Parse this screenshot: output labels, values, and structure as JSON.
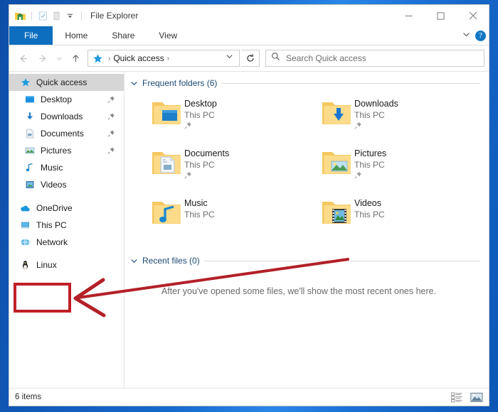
{
  "window": {
    "title": "File Explorer",
    "quick_access_toolbar": [
      {
        "name": "app-icon",
        "icon": "folder-home-icon"
      },
      {
        "name": "properties-button",
        "icon": "properties-icon"
      },
      {
        "name": "new-folder-button",
        "icon": "new-folder-icon"
      },
      {
        "name": "customize-toolbar-button",
        "icon": "chevron-down-icon"
      }
    ],
    "controls": [
      {
        "name": "minimize-button",
        "icon": "minimize-icon"
      },
      {
        "name": "maximize-button",
        "icon": "maximize-icon"
      },
      {
        "name": "close-button",
        "icon": "close-icon"
      }
    ]
  },
  "ribbon": {
    "tabs": [
      {
        "label": "File",
        "active": true
      },
      {
        "label": "Home",
        "active": false
      },
      {
        "label": "Share",
        "active": false
      },
      {
        "label": "View",
        "active": false
      }
    ],
    "expand_icon": "chevron-down-icon",
    "help_label": "?"
  },
  "addressbar": {
    "back_icon": "arrow-left-icon",
    "forward_icon": "arrow-right-icon",
    "recent_icon": "chevron-down-icon",
    "up_icon": "arrow-up-icon",
    "path_icon": "star-icon",
    "path_label": "Quick access",
    "path_separator": "›",
    "dropdown_icon": "chevron-down-icon",
    "refresh_icon": "refresh-icon"
  },
  "search": {
    "icon": "search-icon",
    "placeholder": "Search Quick access",
    "value": ""
  },
  "sidebar": {
    "items": [
      {
        "label": "Quick access",
        "icon": "star-icon",
        "selected": true,
        "root": true,
        "pinned": false
      },
      {
        "label": "Desktop",
        "icon": "desktop-icon",
        "selected": false,
        "root": false,
        "pinned": true
      },
      {
        "label": "Downloads",
        "icon": "downloads-icon",
        "selected": false,
        "root": false,
        "pinned": true
      },
      {
        "label": "Documents",
        "icon": "documents-icon",
        "selected": false,
        "root": false,
        "pinned": true
      },
      {
        "label": "Pictures",
        "icon": "pictures-icon",
        "selected": false,
        "root": false,
        "pinned": true
      },
      {
        "label": "Music",
        "icon": "music-icon",
        "selected": false,
        "root": false,
        "pinned": false
      },
      {
        "label": "Videos",
        "icon": "videos-icon",
        "selected": false,
        "root": false,
        "pinned": false
      },
      {
        "label": "OneDrive",
        "icon": "onedrive-cloud-icon",
        "selected": false,
        "root": true,
        "pinned": false
      },
      {
        "label": "This PC",
        "icon": "this-pc-icon",
        "selected": false,
        "root": true,
        "pinned": false
      },
      {
        "label": "Network",
        "icon": "network-icon",
        "selected": false,
        "root": true,
        "pinned": false
      },
      {
        "label": "Linux",
        "icon": "linux-penguin-icon",
        "selected": false,
        "root": true,
        "pinned": false,
        "highlighted": true
      }
    ]
  },
  "content": {
    "frequent": {
      "header": "Frequent folders (6)",
      "collapse_icon": "chevron-down-icon",
      "folders": [
        {
          "name": "Desktop",
          "location": "This PC",
          "icon": "folder-desktop-icon",
          "pinned": true
        },
        {
          "name": "Downloads",
          "location": "This PC",
          "icon": "folder-downloads-icon",
          "pinned": true
        },
        {
          "name": "Documents",
          "location": "This PC",
          "icon": "folder-documents-icon",
          "pinned": true
        },
        {
          "name": "Pictures",
          "location": "This PC",
          "icon": "folder-pictures-icon",
          "pinned": true
        },
        {
          "name": "Music",
          "location": "This PC",
          "icon": "folder-music-icon",
          "pinned": false
        },
        {
          "name": "Videos",
          "location": "This PC",
          "icon": "folder-videos-icon",
          "pinned": false
        }
      ]
    },
    "recent": {
      "header": "Recent files (0)",
      "collapse_icon": "chevron-down-icon",
      "empty_message": "After you've opened some files, we'll show the most recent ones here."
    }
  },
  "statusbar": {
    "item_count": "6 items",
    "views": [
      {
        "name": "details-view-button",
        "icon": "details-view-icon"
      },
      {
        "name": "large-icons-view-button",
        "icon": "large-icons-view-icon"
      }
    ]
  },
  "annotations": {
    "highlight_color": "#c01f28",
    "arrow_color": "#b32028",
    "box_target": "Linux"
  }
}
